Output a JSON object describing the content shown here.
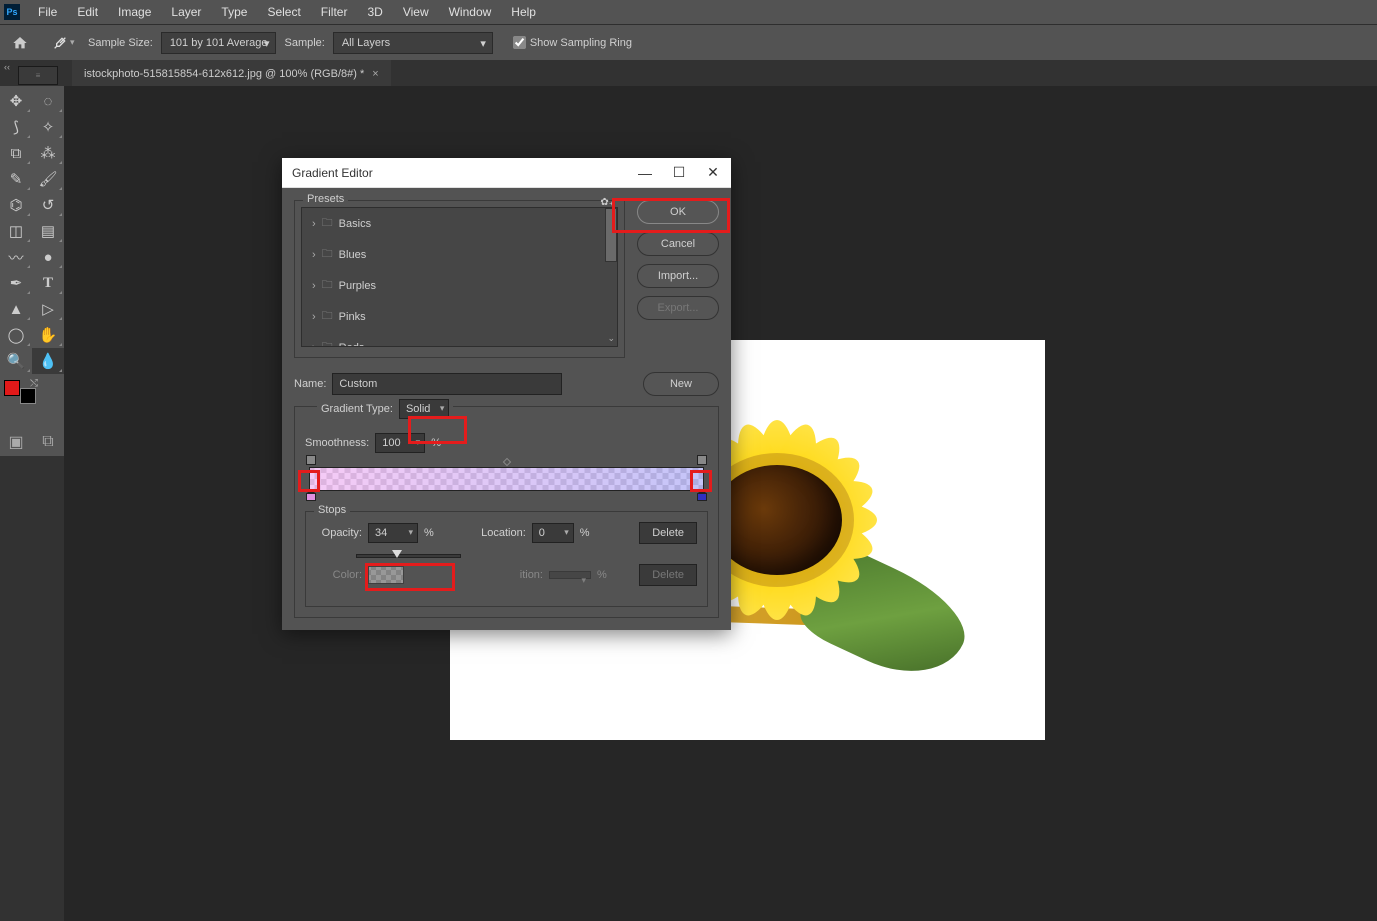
{
  "app": {
    "icon_label": "Ps"
  },
  "menu": [
    "File",
    "Edit",
    "Image",
    "Layer",
    "Type",
    "Select",
    "Filter",
    "3D",
    "View",
    "Window",
    "Help"
  ],
  "options": {
    "sample_size_label": "Sample Size:",
    "sample_size_value": "101 by 101 Average",
    "sample_label": "Sample:",
    "sample_value": "All Layers",
    "show_ring": "Show Sampling Ring"
  },
  "tab": {
    "title": "istockphoto-515815854-612x612.jpg @ 100% (RGB/8#) *"
  },
  "tools": {
    "grid": [
      [
        "move-tool",
        "marquee-tool"
      ],
      [
        "lasso-tool",
        "magic-wand-tool"
      ],
      [
        "crop-tool",
        "eyedropper-tool"
      ],
      [
        "spot-heal-tool",
        "brush-tool"
      ],
      [
        "clone-tool",
        "history-brush-tool"
      ],
      [
        "eraser-tool",
        "gradient-tool"
      ],
      [
        "blur-tool",
        "dodge-tool"
      ],
      [
        "pen-tool",
        "type-tool"
      ],
      [
        "path-select-tool",
        "direct-select-tool"
      ],
      [
        "shape-tool",
        "hand-tool"
      ],
      [
        "zoom-tool",
        "color-sampler-tool"
      ]
    ],
    "icons": {
      "move-tool": "✥",
      "marquee-tool": "◌",
      "lasso-tool": "⟆",
      "magic-wand-tool": "✧",
      "crop-tool": "⧉",
      "eyedropper-tool": "⁂",
      "spot-heal-tool": "✎",
      "brush-tool": "🖌",
      "clone-tool": "⌬",
      "history-brush-tool": "↺",
      "eraser-tool": "◫",
      "gradient-tool": "▤",
      "blur-tool": "〰",
      "dodge-tool": "●",
      "pen-tool": "✒",
      "type-tool": "T",
      "path-select-tool": "▲",
      "direct-select-tool": "▷",
      "shape-tool": "◯",
      "hand-tool": "✋",
      "zoom-tool": "🔍",
      "color-sampler-tool": "💧"
    },
    "fg_color": "#e21919",
    "bg_color": "#000000"
  },
  "dialog": {
    "title": "Gradient Editor",
    "presets_label": "Presets",
    "folders": [
      "Basics",
      "Blues",
      "Purples",
      "Pinks",
      "Reds"
    ],
    "buttons": {
      "ok": "OK",
      "cancel": "Cancel",
      "import": "Import...",
      "export": "Export..."
    },
    "name_label": "Name:",
    "name_value": "Custom",
    "new_label": "New",
    "gradient_type_label": "Gradient Type:",
    "gradient_type_value": "Solid",
    "smoothness_label": "Smoothness:",
    "smoothness_value": "100",
    "percent": "%",
    "stops": {
      "label": "Stops",
      "opacity_label": "Opacity:",
      "opacity_value": "34",
      "location_label": "Location:",
      "location_value": "0",
      "color_label": "Color:",
      "delete": "Delete"
    }
  }
}
